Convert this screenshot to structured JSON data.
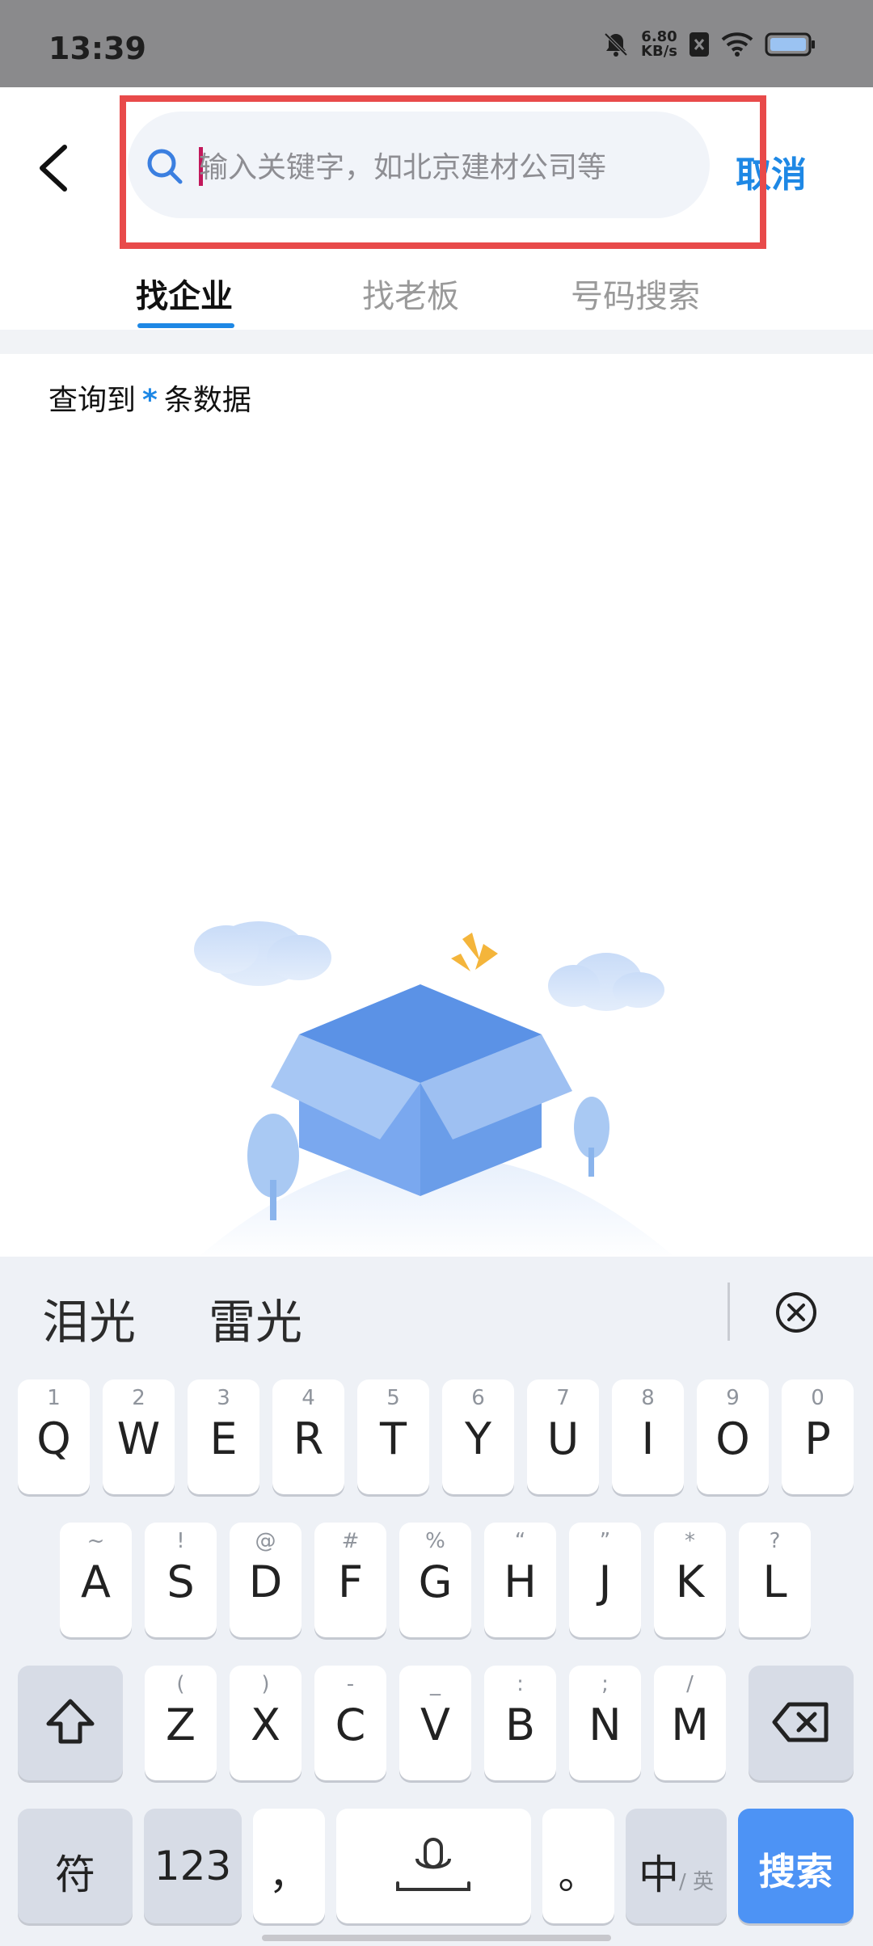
{
  "status_bar": {
    "time": "13:39",
    "net_speed_value": "6.80",
    "net_speed_unit": "KB/s"
  },
  "header": {
    "search_placeholder": "输入关键字，如北京建材公司等",
    "cancel_label": "取消"
  },
  "tabs": [
    {
      "label": "找企业",
      "active": true
    },
    {
      "label": "找老板",
      "active": false
    },
    {
      "label": "号码搜索",
      "active": false
    }
  ],
  "result": {
    "prefix": "查询到",
    "count": "*",
    "suffix": "条数据"
  },
  "keyboard": {
    "candidates": [
      "泪光",
      "雷光"
    ],
    "row1": [
      {
        "hint": "1",
        "key": "Q"
      },
      {
        "hint": "2",
        "key": "W"
      },
      {
        "hint": "3",
        "key": "E"
      },
      {
        "hint": "4",
        "key": "R"
      },
      {
        "hint": "5",
        "key": "T"
      },
      {
        "hint": "6",
        "key": "Y"
      },
      {
        "hint": "7",
        "key": "U"
      },
      {
        "hint": "8",
        "key": "I"
      },
      {
        "hint": "9",
        "key": "O"
      },
      {
        "hint": "0",
        "key": "P"
      }
    ],
    "row2": [
      {
        "hint": "~",
        "key": "A"
      },
      {
        "hint": "!",
        "key": "S"
      },
      {
        "hint": "@",
        "key": "D"
      },
      {
        "hint": "#",
        "key": "F"
      },
      {
        "hint": "%",
        "key": "G"
      },
      {
        "hint": "“",
        "key": "H"
      },
      {
        "hint": "”",
        "key": "J"
      },
      {
        "hint": "*",
        "key": "K"
      },
      {
        "hint": "?",
        "key": "L"
      }
    ],
    "row3": [
      {
        "hint": "(",
        "key": "Z"
      },
      {
        "hint": ")",
        "key": "X"
      },
      {
        "hint": "-",
        "key": "C"
      },
      {
        "hint": "_",
        "key": "V"
      },
      {
        "hint": ":",
        "key": "B"
      },
      {
        "hint": ";",
        "key": "N"
      },
      {
        "hint": "/",
        "key": "M"
      }
    ],
    "bottom": {
      "symbols": "符",
      "numbers": "123",
      "comma": "，",
      "period": "。",
      "lang_main": "中",
      "lang_alt": "/ 英",
      "search": "搜索"
    }
  },
  "colors": {
    "accent": "#1e88e5",
    "highlight": "#e84a4a",
    "search_key": "#4d93f5"
  }
}
